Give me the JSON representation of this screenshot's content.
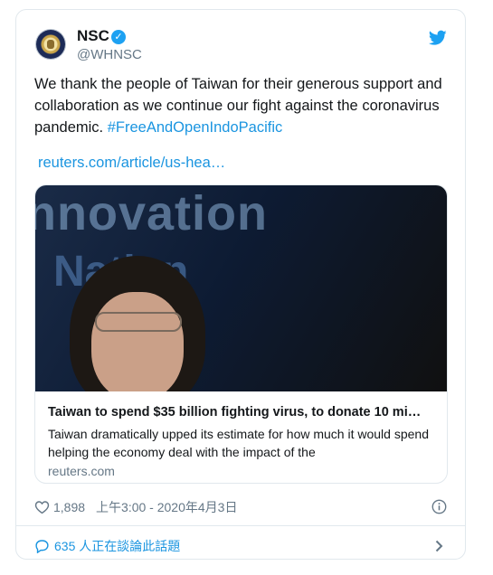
{
  "account": {
    "name": "NSC",
    "handle": "@WHNSC",
    "verified_mark": "✓"
  },
  "tweet": {
    "text_before": "We thank the people of Taiwan for their generous support and collaboration as we continue our fight against the coronavirus pandemic. ",
    "hashtag": "#FreeAndOpenIndoPacific",
    "link": "reuters.com/article/us-hea…"
  },
  "card": {
    "image_text_line1": "nnovation",
    "image_text_line2": "Nation",
    "title": "Taiwan to spend $35 billion fighting virus, to donate 10 mi…",
    "description": "Taiwan dramatically upped its estimate for how much it would spend helping the economy deal with the impact of the",
    "domain": "reuters.com"
  },
  "meta": {
    "likes": "1,898",
    "timestamp": "上午3:00 - 2020年4月3日"
  },
  "conversation": {
    "label": "635 人正在談論此話題"
  },
  "colors": {
    "accent": "#1da1f2",
    "link": "#1b95e0",
    "muted": "#657786",
    "border": "#e1e8ed"
  },
  "icons": [
    "seal-avatar-icon",
    "verified-badge-icon",
    "twitter-bird-icon",
    "heart-icon",
    "info-icon",
    "speech-bubble-icon",
    "chevron-right-icon"
  ]
}
